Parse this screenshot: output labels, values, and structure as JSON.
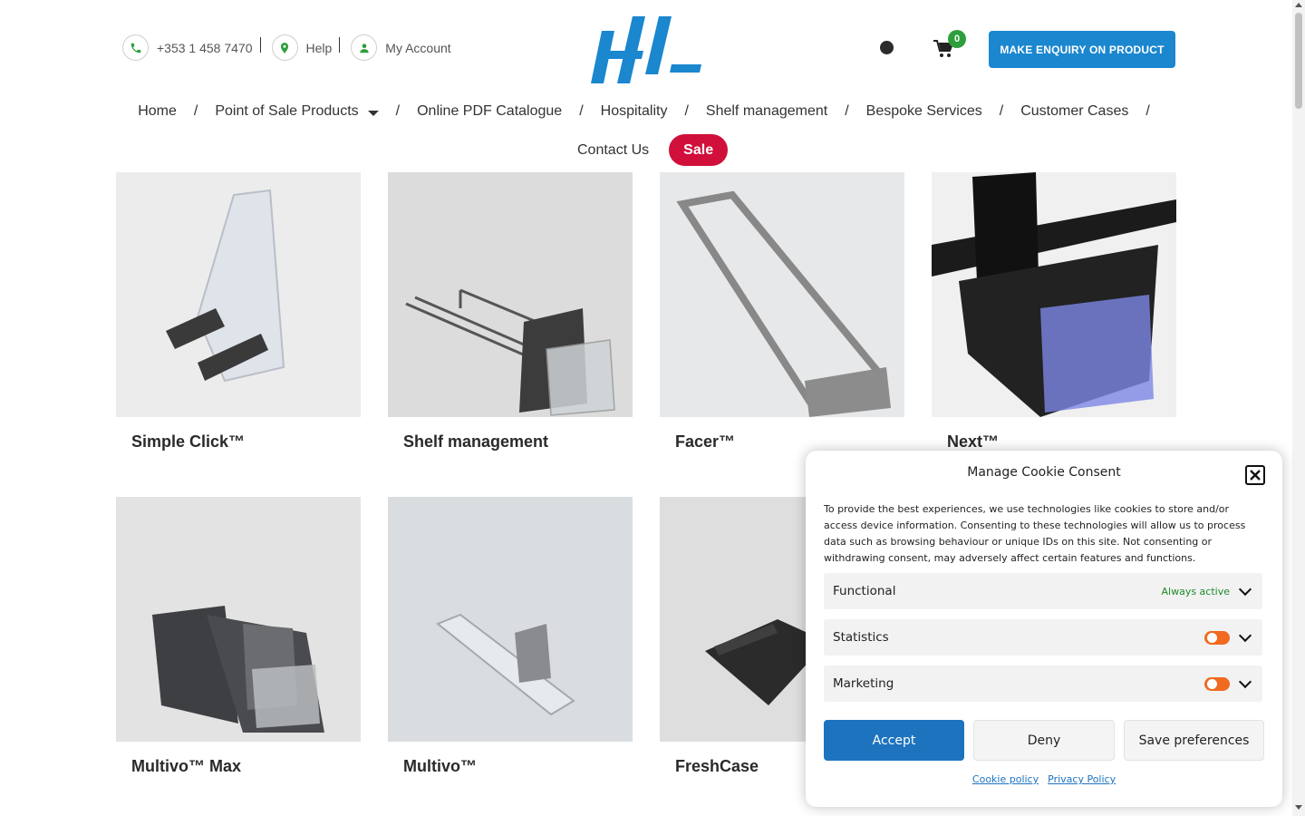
{
  "header": {
    "phone": "+353 1 458 7470",
    "help": "Help",
    "account": "My Account",
    "cart_count": "0",
    "enquiry_button": "MAKE ENQUIRY ON PRODUCT",
    "accent_color": "#1a87cf"
  },
  "nav": {
    "items": [
      "Home",
      "Point of Sale Products",
      "Online PDF Catalogue",
      "Hospitality",
      "Shelf management",
      "Bespoke Services",
      "Customer Cases"
    ],
    "contact": "Contact Us",
    "sale": "Sale",
    "separator": "/"
  },
  "products": [
    {
      "title": "Simple Click™"
    },
    {
      "title": "Shelf management"
    },
    {
      "title": "Facer™"
    },
    {
      "title": "Next™"
    },
    {
      "title": "Multivo™ Max"
    },
    {
      "title": "Multivo™"
    },
    {
      "title": "FreshCase"
    }
  ],
  "cookie": {
    "title": "Manage Cookie Consent",
    "description": "To provide the best experiences, we use technologies like cookies to store and/or access device information. Consenting to these technologies will allow us to process data such as browsing behaviour or unique IDs on this site. Not consenting or withdrawing consent, may adversely affect certain features and functions.",
    "categories": [
      {
        "label": "Functional",
        "status": "Always active"
      },
      {
        "label": "Statistics"
      },
      {
        "label": "Marketing"
      }
    ],
    "accept": "Accept",
    "deny": "Deny",
    "save": "Save preferences",
    "cookie_policy": "Cookie policy",
    "privacy_policy": "Privacy Policy"
  }
}
